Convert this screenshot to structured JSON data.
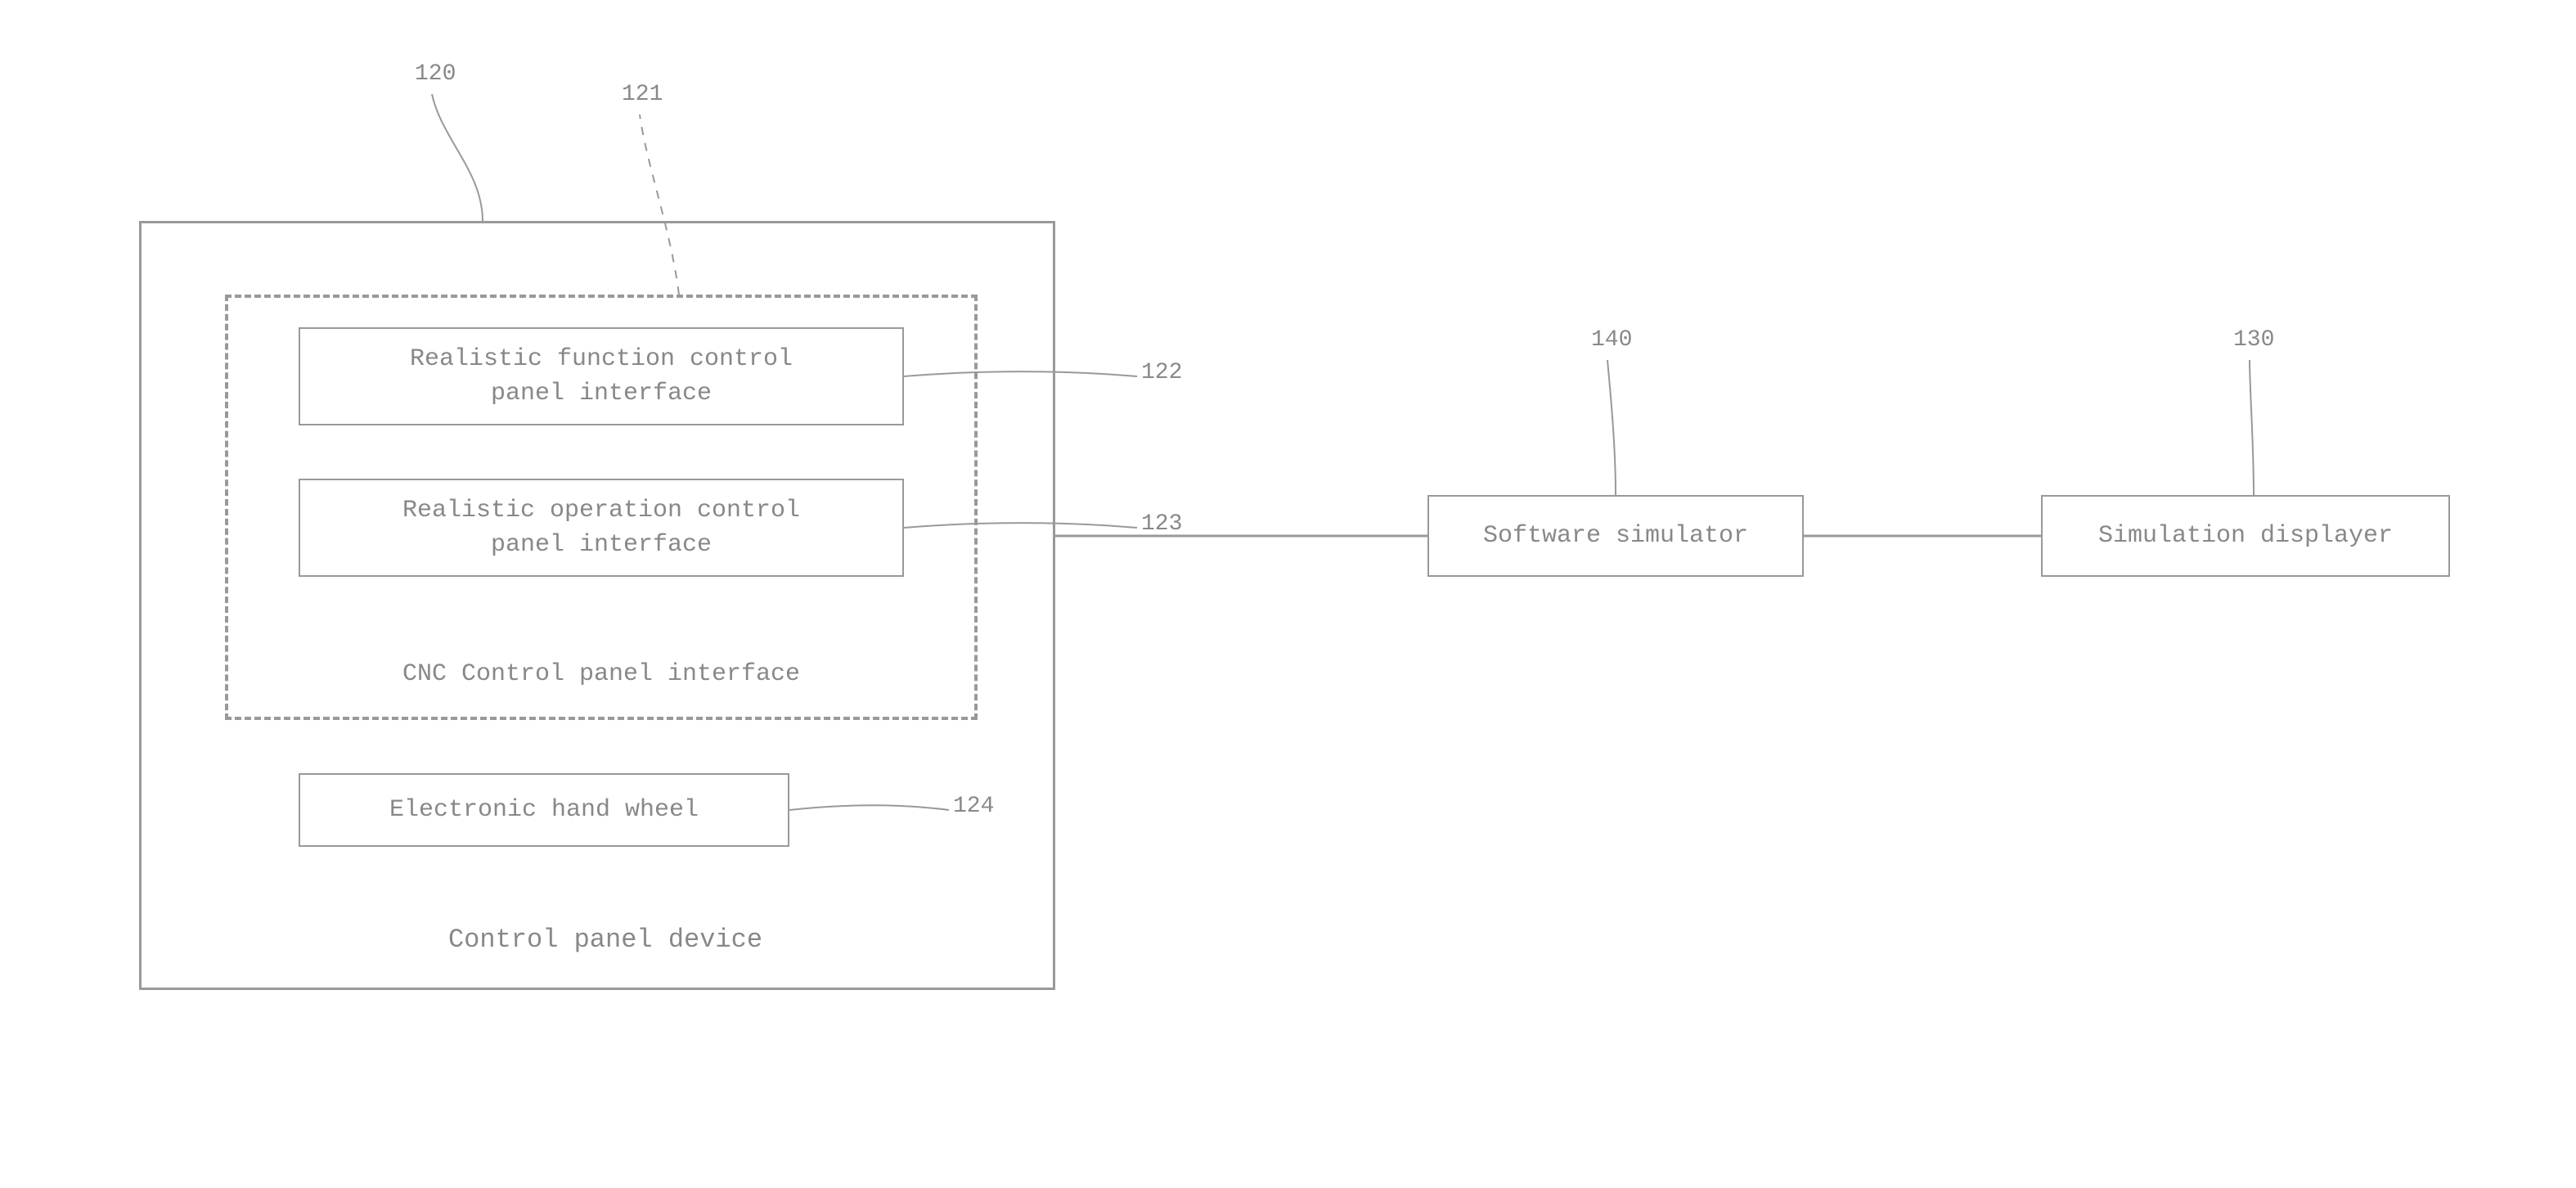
{
  "refs": {
    "r120": "120",
    "r121": "121",
    "r122": "122",
    "r123": "123",
    "r124": "124",
    "r130": "130",
    "r140": "140"
  },
  "blocks": {
    "control_panel_device": "Control panel device",
    "cnc_interface": "CNC Control panel interface",
    "realistic_function": "Realistic function control\npanel interface",
    "realistic_operation": "Realistic operation control\npanel interface",
    "hand_wheel": "Electronic hand wheel",
    "software_simulator": "Software simulator",
    "simulation_displayer": "Simulation displayer"
  }
}
